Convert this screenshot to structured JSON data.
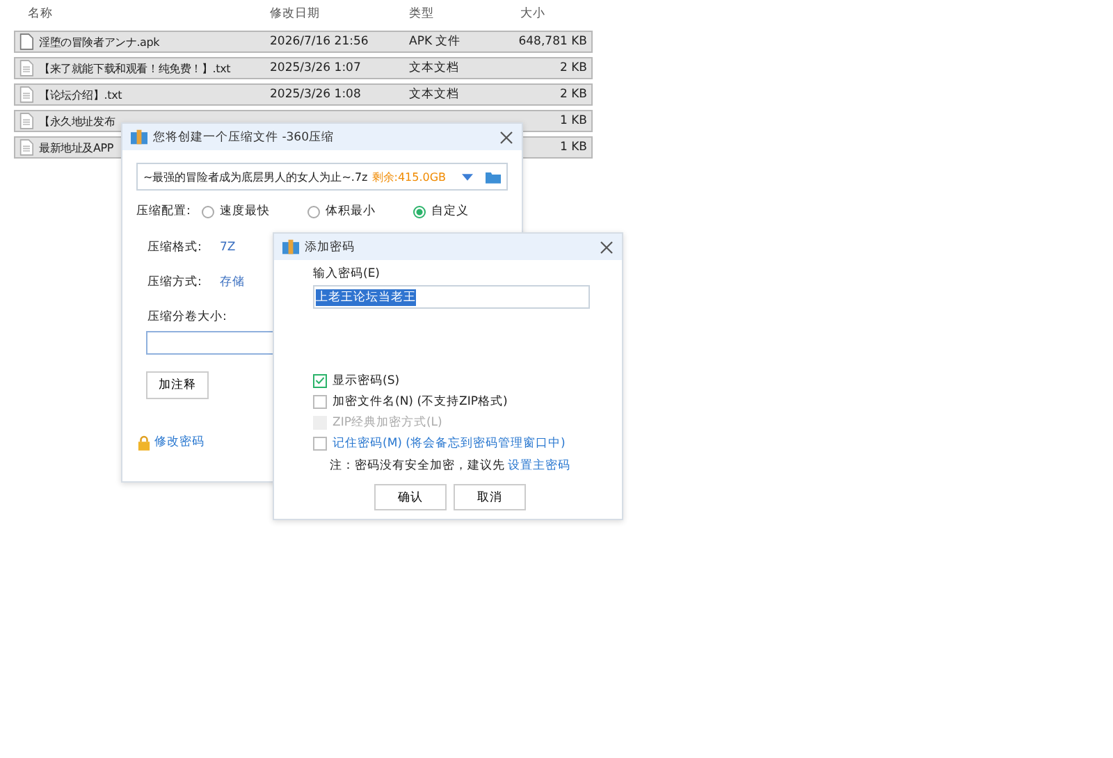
{
  "columns": [
    "名称",
    "修改日期",
    "类型",
    "大小"
  ],
  "files": [
    {
      "name": "淫堕の冒険者アンナ.apk",
      "date": "2026/7/16 21:56",
      "type": "APK 文件",
      "size": "648,781 KB",
      "kind": "apk"
    },
    {
      "name": "【来了就能下载和观看！纯免费！】.txt",
      "date": "2025/3/26 1:07",
      "type": "文本文档",
      "size": "2 KB",
      "kind": "txt"
    },
    {
      "name": "【论坛介绍】.txt",
      "date": "2025/3/26 1:08",
      "type": "文本文档",
      "size": "2 KB",
      "kind": "txt"
    },
    {
      "name": "【永久地址发布",
      "size": "1 KB",
      "kind": "txt"
    },
    {
      "name": "最新地址及APP",
      "size": "1 KB",
      "kind": "txt"
    }
  ],
  "compress_dialog": {
    "title": "您将创建一个压缩文件 -360压缩",
    "path": "~最强的冒险者成为底层男人的女人为止~.7z",
    "free_space": "剩余:415.0GB",
    "config_label": "压缩配置:",
    "presets": [
      {
        "label": "速度最快",
        "selected": false
      },
      {
        "label": "体积最小",
        "selected": false
      },
      {
        "label": "自定义",
        "selected": true
      }
    ],
    "format_label": "压缩格式:",
    "format": "7Z",
    "method_label": "压缩方式:",
    "method": "存储",
    "split_label": "压缩分卷大小:",
    "comment_button": "加注释",
    "change_password": "修改密码"
  },
  "password_dialog": {
    "title": "添加密码",
    "field_label": "输入密码(E)",
    "password": "上老王论坛当老王",
    "options": [
      {
        "label": "显示密码(S)",
        "checked": true,
        "disabled": false,
        "link": false
      },
      {
        "label": "加密文件名(N) (不支持ZIP格式)",
        "checked": false,
        "disabled": false,
        "link": false
      },
      {
        "label": "ZIP经典加密方式(L)",
        "checked": false,
        "disabled": true,
        "link": false
      },
      {
        "label": "记住密码(M) (将会备忘到密码管理窗口中)",
        "checked": false,
        "disabled": false,
        "link": true
      }
    ],
    "note": "注：密码没有安全加密，建议先",
    "note_link": "设置主密码",
    "buttons": [
      "确认",
      "取消"
    ]
  }
}
